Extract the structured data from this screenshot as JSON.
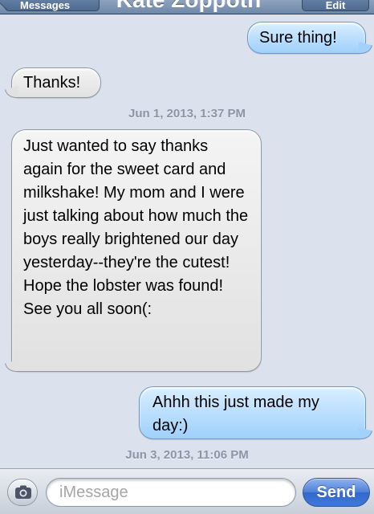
{
  "nav": {
    "back_label": "Messages",
    "title": "Kate Zoppoth",
    "edit_label": "Edit"
  },
  "messages": [
    {
      "type": "sent",
      "text": "Sure thing!"
    },
    {
      "type": "received",
      "text": "Thanks!"
    },
    {
      "type": "timestamp",
      "text": "Jun 1, 2013, 1:37 PM"
    },
    {
      "type": "received",
      "text": "Just wanted to say thanks again for the sweet card and milkshake! My mom and I were just talking about how much the boys really brightened our day yesterday--they're the cutest! Hope the lobster was found! See you all soon(:"
    },
    {
      "type": "sent",
      "text": "Ahhh this just made my day:)"
    },
    {
      "type": "timestamp",
      "text": "Jun 3, 2013, 11:06 PM"
    }
  ],
  "input": {
    "placeholder": "iMessage",
    "camera_icon": "camera-icon",
    "send_label": "Send"
  },
  "colors": {
    "background": "#dbe2ed",
    "sent_bubble": "#9fd0fb",
    "received_bubble": "#e1e1e1",
    "send_button": "#3f78dc",
    "timestamp": "#8b95a6"
  }
}
